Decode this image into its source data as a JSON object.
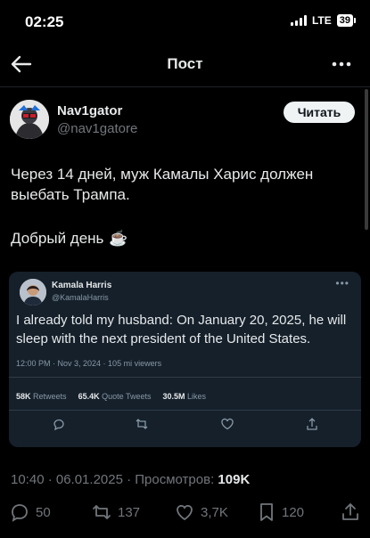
{
  "status": {
    "time": "02:25",
    "network": "LTE",
    "battery": "39"
  },
  "header": {
    "title": "Пост"
  },
  "author": {
    "name": "Nav1gator",
    "handle": "@nav1gatore",
    "read_button": "Читать"
  },
  "post": {
    "lines": [
      "Через 14 дней, муж Камалы Харис должен",
      "выебать Трампа."
    ],
    "greeting": "Добрый день",
    "greeting_emoji": "☕"
  },
  "quoted": {
    "name": "Kamala Harris",
    "handle": "@KamalaHarris",
    "lines": [
      "I already told my husband: On January 20, 2025, he will",
      "sleep with the next president of the United States."
    ],
    "meta": "12:00 PM · Nov 3, 2024 · 105 mi viewers",
    "retweets_value": "58K",
    "retweets_label": "Retweets",
    "quotes_value": "65.4K",
    "quotes_label": "Quote Tweets",
    "likes_value": "30.5M",
    "likes_label": "Likes"
  },
  "meta": {
    "time_date": "10:40 · 06.01.2025 · Просмотров: ",
    "views": "109K"
  },
  "actions": {
    "replies": "50",
    "reposts": "137",
    "likes": "3,7K",
    "bookmarks": "120"
  },
  "icons": {
    "back": "arrow-left-icon",
    "more": "more-horizontal-icon",
    "reply": "reply-icon",
    "repost": "repost-icon",
    "like": "heart-icon",
    "bookmark": "bookmark-icon",
    "share": "share-icon"
  }
}
